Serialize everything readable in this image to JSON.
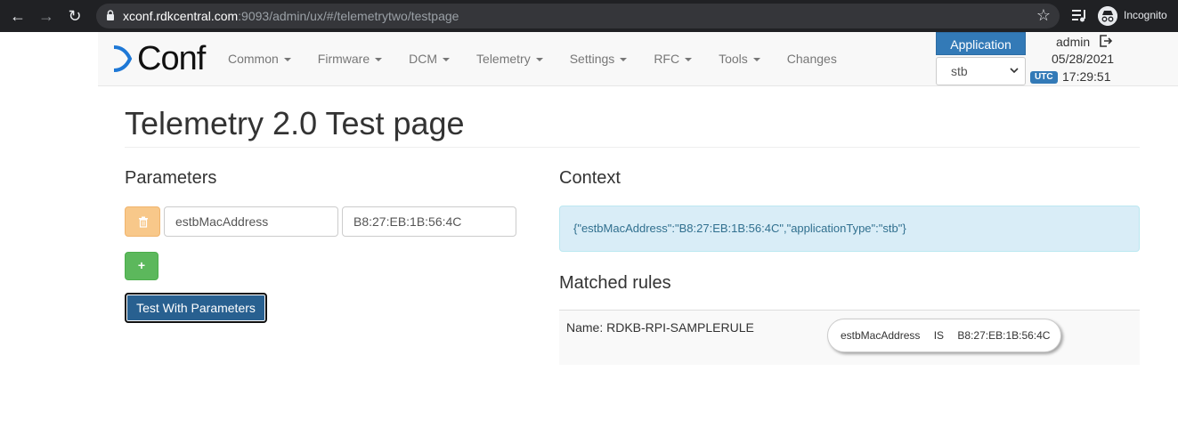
{
  "browser": {
    "url_host": "xconf.rdkcentral.com",
    "url_rest": ":9093/admin/ux/#/telemetrytwo/testpage",
    "incognito_label": "Incognito"
  },
  "navbar": {
    "logo": "Conf",
    "menu": [
      {
        "label": "Common",
        "dropdown": true
      },
      {
        "label": "Firmware",
        "dropdown": true
      },
      {
        "label": "DCM",
        "dropdown": true
      },
      {
        "label": "Telemetry",
        "dropdown": true
      },
      {
        "label": "Settings",
        "dropdown": true
      },
      {
        "label": "RFC",
        "dropdown": true
      },
      {
        "label": "Tools",
        "dropdown": true
      },
      {
        "label": "Changes",
        "dropdown": false
      }
    ],
    "application_button": "Application",
    "application_selected": "stb",
    "user": "admin",
    "date": "05/28/2021",
    "timezone": "UTC",
    "time": "17:29:51"
  },
  "page": {
    "title": "Telemetry 2.0 Test page",
    "parameters_heading": "Parameters",
    "parameter": {
      "key": "estbMacAddress",
      "value": "B8:27:EB:1B:56:4C"
    },
    "add_label": "+",
    "test_button": "Test With Parameters",
    "context_heading": "Context",
    "context_value": "{\"estbMacAddress\":\"B8:27:EB:1B:56:4C\",\"applicationType\":\"stb\"}",
    "matched_heading": "Matched rules",
    "rule": {
      "name": "Name: RDKB-RPI-SAMPLERULE",
      "condition_key": "estbMacAddress",
      "condition_op": "IS",
      "condition_value": "B8:27:EB:1B:56:4C"
    }
  },
  "colors": {
    "primary": "#337ab7",
    "success": "#5cb85c",
    "warning": "#f8c88a",
    "info_bg": "#d9edf7",
    "info_text": "#31708f"
  }
}
